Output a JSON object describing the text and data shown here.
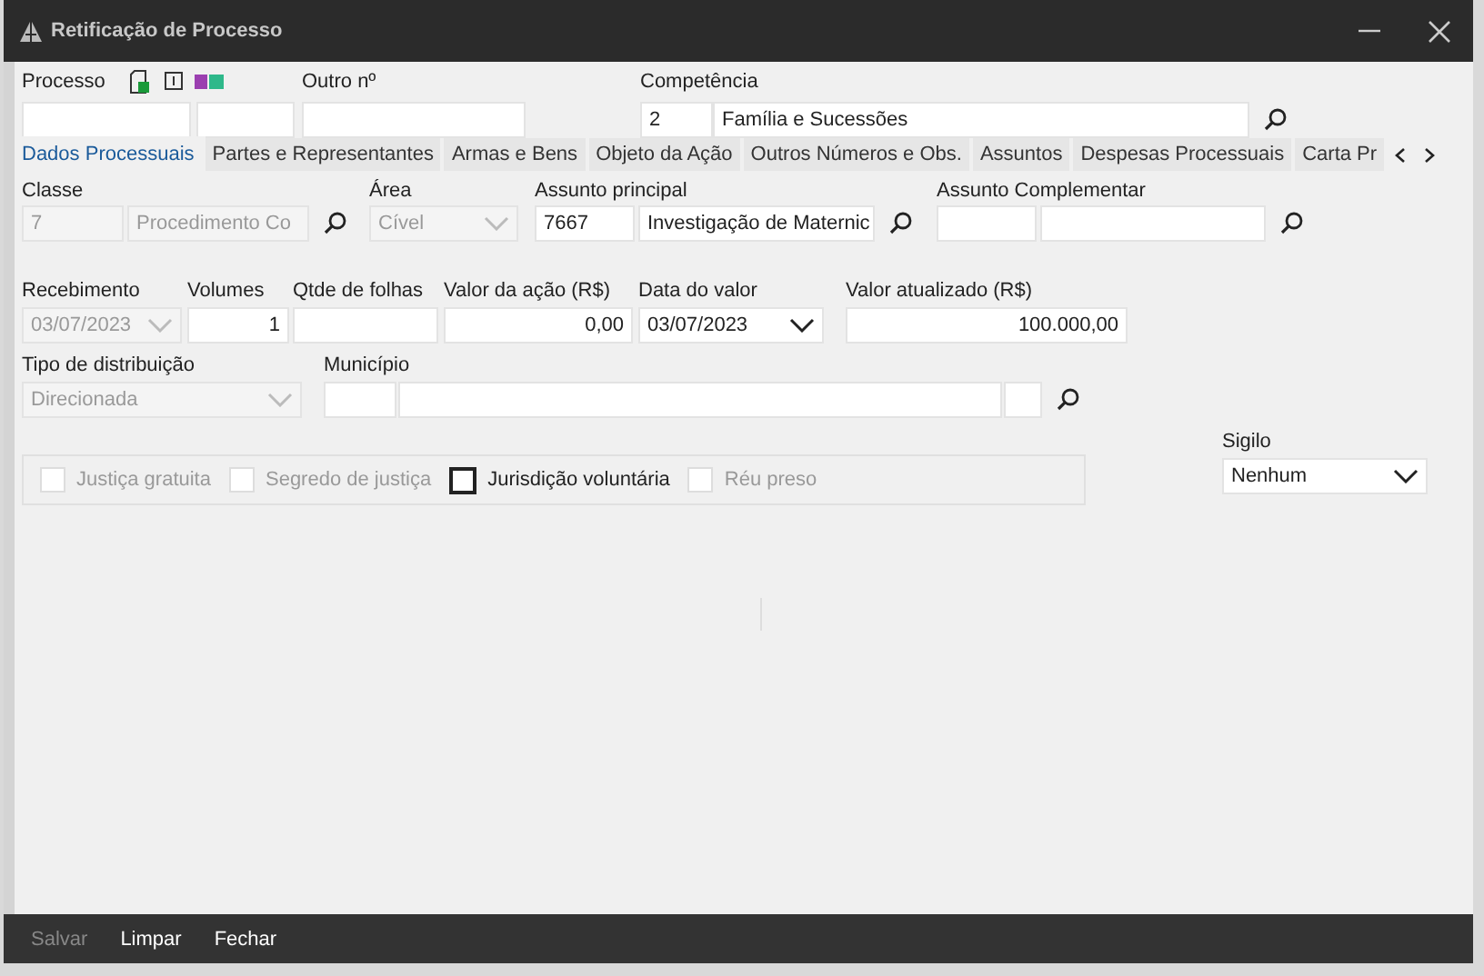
{
  "window": {
    "title": "Retificação de Processo"
  },
  "header": {
    "processo": {
      "label": "Processo"
    },
    "outro": {
      "label": "Outro nº"
    },
    "competencia": {
      "label": "Competência",
      "code": "2",
      "name": "Família e Sucessões"
    }
  },
  "tabs": [
    {
      "label": "Dados Processuais",
      "selected": true
    },
    {
      "label": "Partes e Representantes",
      "selected": false
    },
    {
      "label": "Armas e Bens",
      "selected": false
    },
    {
      "label": "Objeto da Ação",
      "selected": false
    },
    {
      "label": "Outros Números e Obs.",
      "selected": false
    },
    {
      "label": "Assuntos",
      "selected": false
    },
    {
      "label": "Despesas Processuais",
      "selected": false
    },
    {
      "label": "Carta Pr",
      "selected": false
    }
  ],
  "classe": {
    "label": "Classe",
    "code": "7",
    "name": "Procedimento Co",
    "disabled": true
  },
  "area": {
    "label": "Área",
    "value": "Cível",
    "disabled": true
  },
  "assunto_principal": {
    "label": "Assunto principal",
    "code": "7667",
    "name": "Investigação de Maternic"
  },
  "assunto_complementar": {
    "label": "Assunto Complementar"
  },
  "recebimento": {
    "label": "Recebimento",
    "value": "03/07/2023",
    "disabled": true
  },
  "volumes": {
    "label": "Volumes",
    "value": "1"
  },
  "qtde_folhas": {
    "label": "Qtde de folhas"
  },
  "valor_acao": {
    "label": "Valor da ação (R$)",
    "value": "0,00"
  },
  "data_valor": {
    "label": "Data do valor",
    "value": "03/07/2023",
    "disabled": false
  },
  "valor_atualizado": {
    "label": "Valor atualizado (R$)",
    "value": "100.000,00"
  },
  "tipo_distribuicao": {
    "label": "Tipo de distribuição",
    "value": "Direcionada",
    "disabled": true
  },
  "municipio": {
    "label": "Município"
  },
  "checkboxes": [
    {
      "label": "Justiça gratuita",
      "checked": false,
      "disabled": true
    },
    {
      "label": "Segredo de justiça",
      "checked": false,
      "disabled": true
    },
    {
      "label": "Jurisdição voluntária",
      "checked": false,
      "disabled": false
    },
    {
      "label": "Réu preso",
      "checked": false,
      "disabled": true
    }
  ],
  "sigilo": {
    "label": "Sigilo",
    "value": "Nenhum"
  },
  "buttons": [
    {
      "label": "Salvar",
      "disabled": true
    },
    {
      "label": "Limpar",
      "disabled": false
    },
    {
      "label": "Fechar",
      "disabled": false
    }
  ]
}
